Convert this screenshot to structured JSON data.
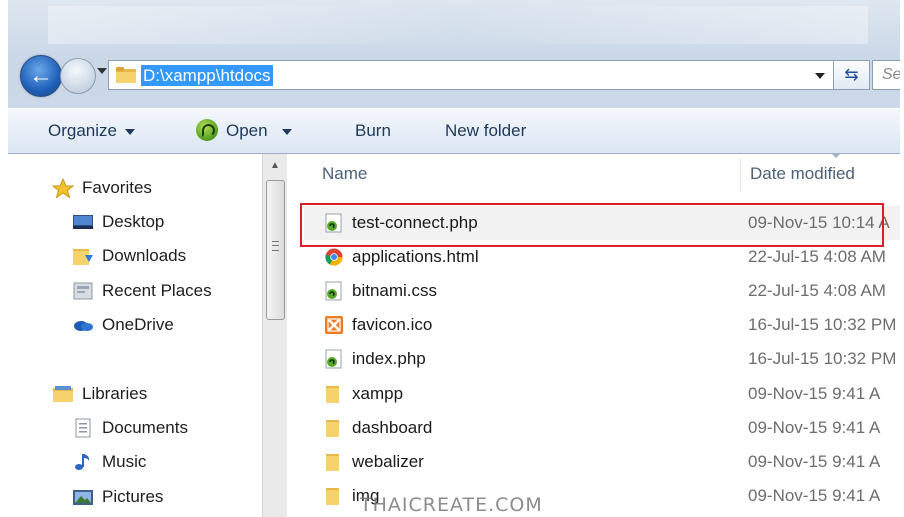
{
  "address_bar": {
    "path": "D:\\xampp\\htdocs",
    "search_placeholder": "Sea"
  },
  "toolbar": {
    "organize_label": "Organize",
    "open_label": "Open",
    "burn_label": "Burn",
    "new_folder_label": "New folder"
  },
  "navigation": {
    "items": [
      {
        "label": "Favorites",
        "icon": "star-icon"
      },
      {
        "label": "Desktop",
        "icon": "desktop-icon"
      },
      {
        "label": "Downloads",
        "icon": "downloads-folder-icon"
      },
      {
        "label": "Recent Places",
        "icon": "recent-places-icon"
      },
      {
        "label": "OneDrive",
        "icon": "onedrive-cloud-icon"
      },
      {
        "label": "Libraries",
        "icon": "libraries-icon"
      },
      {
        "label": "Documents",
        "icon": "documents-icon"
      },
      {
        "label": "Music",
        "icon": "music-note-icon"
      },
      {
        "label": "Pictures",
        "icon": "pictures-icon"
      }
    ]
  },
  "file_list": {
    "columns": {
      "name": "Name",
      "date_modified": "Date modified"
    },
    "rows": [
      {
        "name": "test-connect.php",
        "date": "09-Nov-15 10:14 A",
        "icon": "php-file-icon"
      },
      {
        "name": "applications.html",
        "date": "22-Jul-15 4:08 AM",
        "icon": "chrome-html-icon"
      },
      {
        "name": "bitnami.css",
        "date": "22-Jul-15 4:08 AM",
        "icon": "css-file-icon"
      },
      {
        "name": "favicon.ico",
        "date": "16-Jul-15 10:32 PM",
        "icon": "xampp-ico-icon"
      },
      {
        "name": "index.php",
        "date": "16-Jul-15 10:32 PM",
        "icon": "php-file-icon"
      },
      {
        "name": "xampp",
        "date": "09-Nov-15 9:41 A",
        "icon": "folder-icon"
      },
      {
        "name": "dashboard",
        "date": "09-Nov-15 9:41 A",
        "icon": "folder-icon"
      },
      {
        "name": "webalizer",
        "date": "09-Nov-15 9:41 A",
        "icon": "folder-icon"
      },
      {
        "name": "img",
        "date": "09-Nov-15 9:41 A",
        "icon": "folder-icon"
      }
    ]
  },
  "watermark": "THAICREATE.COM",
  "colors": {
    "selection_highlight": "#3399ff",
    "annotation_box": "#d8222a"
  }
}
